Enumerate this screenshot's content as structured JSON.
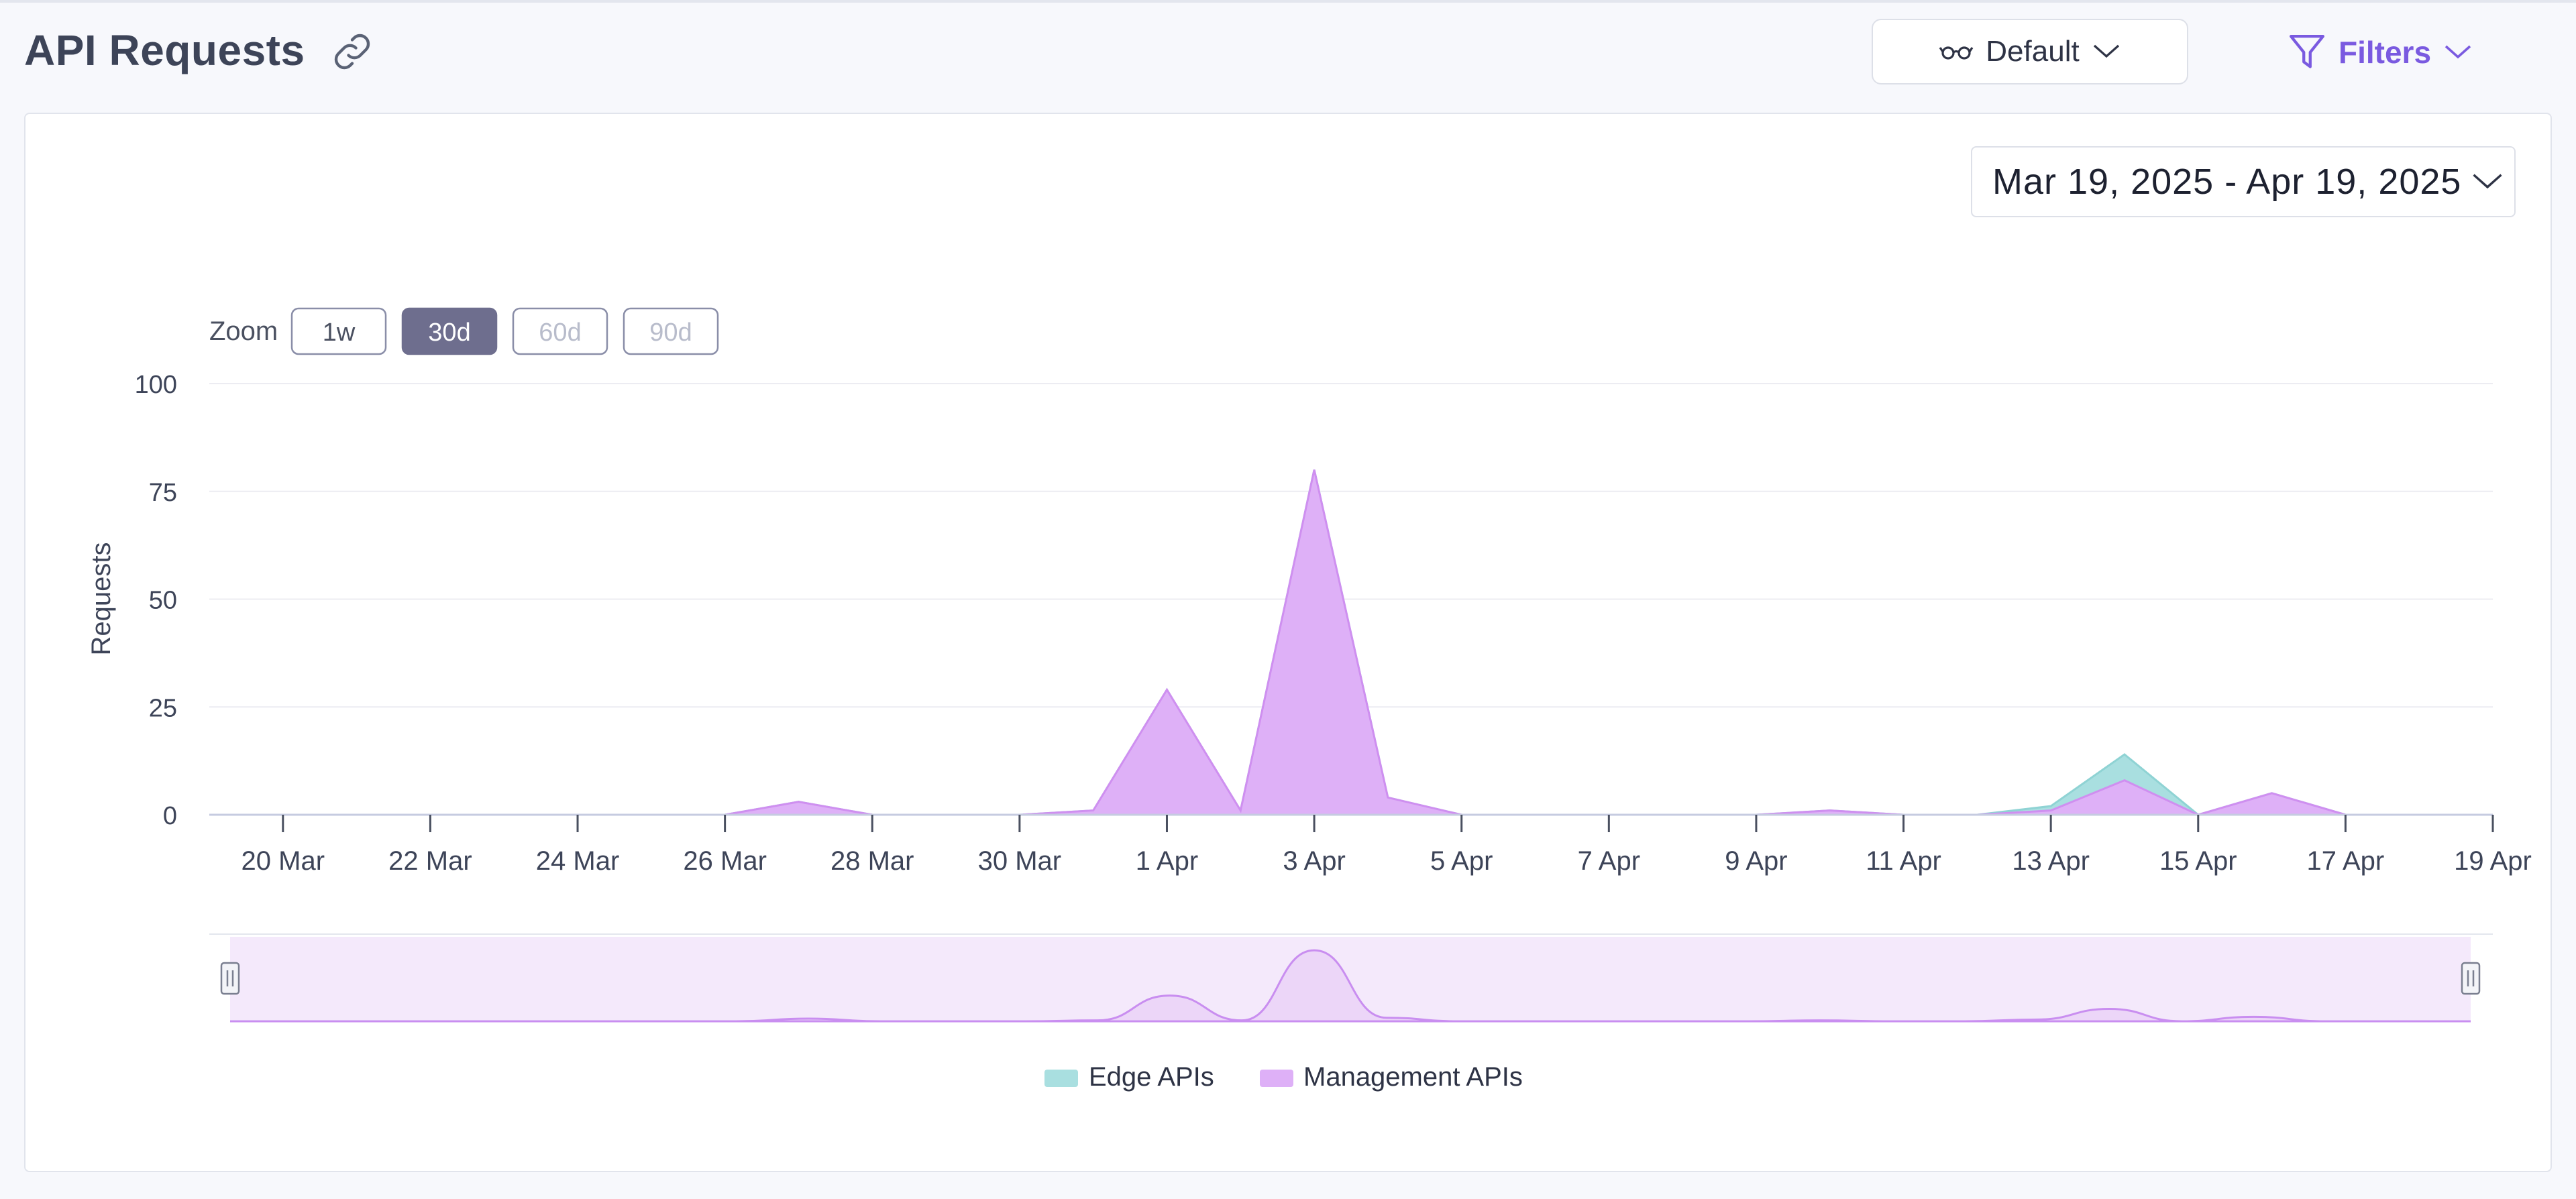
{
  "header": {
    "title": "API Requests",
    "view_label": "Default",
    "filters_label": "Filters"
  },
  "date_range": {
    "label": "Mar 19, 2025 - Apr 19, 2025"
  },
  "zoom": {
    "label": "Zoom",
    "options": [
      {
        "label": "1w",
        "state": "enabled"
      },
      {
        "label": "30d",
        "state": "selected"
      },
      {
        "label": "60d",
        "state": "disabled"
      },
      {
        "label": "90d",
        "state": "disabled"
      }
    ]
  },
  "colors": {
    "accent": "#7a5ae0",
    "edge": "#a9dfe0",
    "edge_line": "#8fd3d4",
    "management": "#deb0f7",
    "management_line": "#cf8ff0",
    "navigator_fill": "#f4e9fb"
  },
  "chart_data": {
    "type": "area",
    "stacked": true,
    "title": "",
    "xlabel": "",
    "ylabel": "Requests",
    "ylim": [
      0,
      100
    ],
    "yticks": [
      0,
      25,
      50,
      75,
      100
    ],
    "xlim": [
      "2025-03-19",
      "2025-04-19"
    ],
    "xticks": [
      "2025-03-20",
      "2025-03-22",
      "2025-03-24",
      "2025-03-26",
      "2025-03-28",
      "2025-03-30",
      "2025-04-01",
      "2025-04-03",
      "2025-04-05",
      "2025-04-07",
      "2025-04-09",
      "2025-04-11",
      "2025-04-13",
      "2025-04-15",
      "2025-04-17",
      "2025-04-19"
    ],
    "xtick_labels": [
      "20 Mar",
      "22 Mar",
      "24 Mar",
      "26 Mar",
      "28 Mar",
      "30 Mar",
      "1 Apr",
      "3 Apr",
      "5 Apr",
      "7 Apr",
      "9 Apr",
      "11 Apr",
      "13 Apr",
      "15 Apr",
      "17 Apr",
      "19 Apr"
    ],
    "grid": true,
    "legend_position": "bottom-center",
    "x": [
      "2025-03-20",
      "2025-03-21",
      "2025-03-22",
      "2025-03-23",
      "2025-03-24",
      "2025-03-25",
      "2025-03-26",
      "2025-03-27",
      "2025-03-28",
      "2025-03-29",
      "2025-03-30",
      "2025-03-31",
      "2025-04-01",
      "2025-04-02",
      "2025-04-03",
      "2025-04-04",
      "2025-04-05",
      "2025-04-06",
      "2025-04-07",
      "2025-04-08",
      "2025-04-09",
      "2025-04-10",
      "2025-04-11",
      "2025-04-12",
      "2025-04-13",
      "2025-04-14",
      "2025-04-15",
      "2025-04-16",
      "2025-04-17",
      "2025-04-18",
      "2025-04-19"
    ],
    "series": [
      {
        "name": "Management APIs",
        "values": [
          0,
          0,
          0,
          0,
          0,
          0,
          0,
          3,
          0,
          0,
          0,
          1,
          29,
          1,
          80,
          4,
          0,
          0,
          0,
          0,
          0,
          1,
          0,
          0,
          1,
          8,
          0,
          5,
          0,
          0,
          0
        ]
      },
      {
        "name": "Edge APIs",
        "values": [
          0,
          0,
          0,
          0,
          0,
          0,
          0,
          0,
          0,
          0,
          0,
          0,
          0,
          0,
          0,
          0,
          0,
          0,
          0,
          0,
          0,
          0,
          0,
          0,
          1,
          6,
          0,
          0,
          0,
          0,
          0
        ]
      }
    ]
  }
}
